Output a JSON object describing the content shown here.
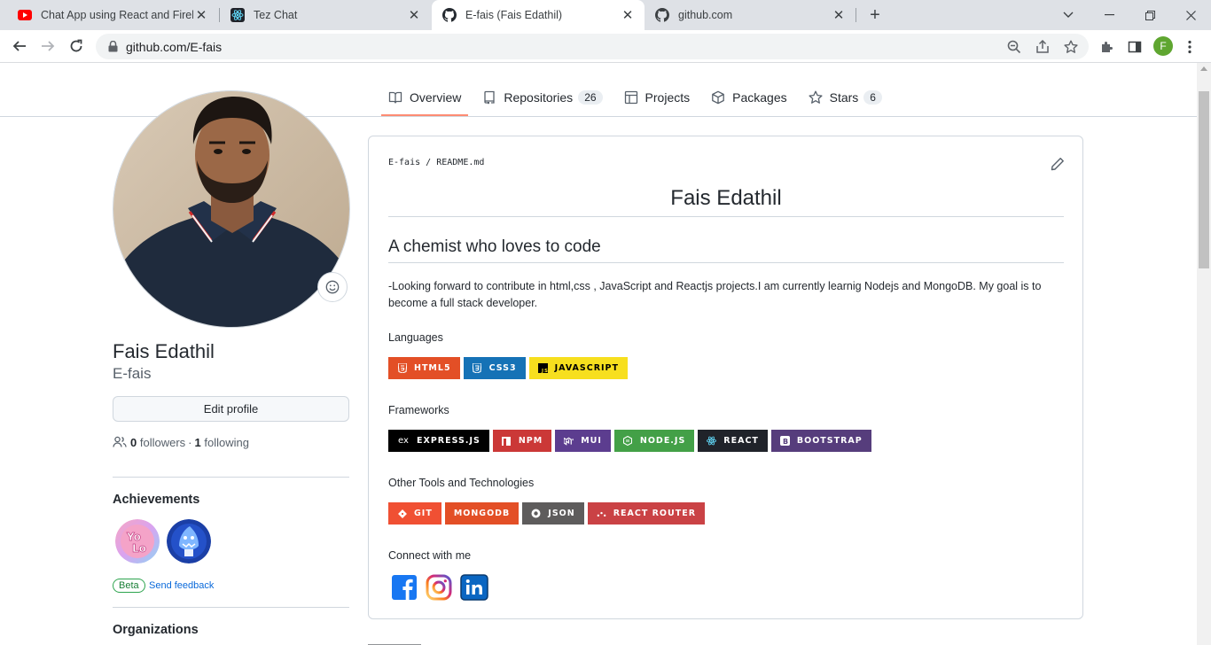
{
  "browser": {
    "tabs": [
      {
        "title": "Chat App using React and Firebase",
        "favicon": "youtube-icon",
        "active": false
      },
      {
        "title": "Tez Chat",
        "favicon": "react-icon",
        "active": false
      },
      {
        "title": "E-fais (Fais Edathil)",
        "favicon": "github-icon",
        "active": true
      },
      {
        "title": "github.com",
        "favicon": "github-icon",
        "active": false
      }
    ],
    "url": "github.com/E-fais",
    "profile_initial": "F"
  },
  "profile_nav": {
    "tabs": [
      {
        "label": "Overview",
        "icon": "book-icon",
        "selected": true
      },
      {
        "label": "Repositories",
        "icon": "repo-icon",
        "count": "26"
      },
      {
        "label": "Projects",
        "icon": "table-icon"
      },
      {
        "label": "Packages",
        "icon": "package-icon"
      },
      {
        "label": "Stars",
        "icon": "star-icon",
        "count": "6"
      }
    ]
  },
  "sidebar": {
    "name": "Fais Edathil",
    "login": "E-fais",
    "edit_label": "Edit profile",
    "followers_count": "0",
    "followers_label": "followers",
    "dot": "·",
    "following_count": "1",
    "following_label": "following",
    "achievements_title": "Achievements",
    "beta_label": "Beta",
    "feedback_label": "Send feedback",
    "organizations_title": "Organizations"
  },
  "readme": {
    "crumb_user": "E-fais",
    "crumb_sep": "/",
    "crumb_file": "README.md",
    "h1": "Fais Edathil",
    "h2": "A chemist who loves to code",
    "paragraph": "-Looking forward to contribute in html,css , JavaScript and Reactjs projects.I am currently learnig Nodejs and MongoDB. My goal is to become a full stack developer.",
    "languages_title": "Languages",
    "languages": [
      {
        "label": "HTML5",
        "color": "#e34f26"
      },
      {
        "label": "CSS3",
        "color": "#1572b6"
      },
      {
        "label": "JAVASCRIPT",
        "color": "#f7df1e"
      }
    ],
    "frameworks_title": "Frameworks",
    "frameworks": [
      {
        "label": "EXPRESS.JS",
        "color": "#000000"
      },
      {
        "label": "NPM",
        "color": "#cb3837"
      },
      {
        "label": "MUI",
        "color": "#5c3d8f"
      },
      {
        "label": "NODE.JS",
        "color": "#43a047"
      },
      {
        "label": "REACT",
        "color": "#20232a"
      },
      {
        "label": "BOOTSTRAP",
        "color": "#563d7c"
      }
    ],
    "tools_title": "Other Tools and Technologies",
    "tools": [
      {
        "label": "GIT",
        "color": "#f05033"
      },
      {
        "label": "MONGODB",
        "color": "#e34f26"
      },
      {
        "label": "JSON",
        "color": "#5e5c5c"
      },
      {
        "label": "REACT ROUTER",
        "color": "#ca4245"
      }
    ],
    "connect_title": "Connect with me"
  }
}
